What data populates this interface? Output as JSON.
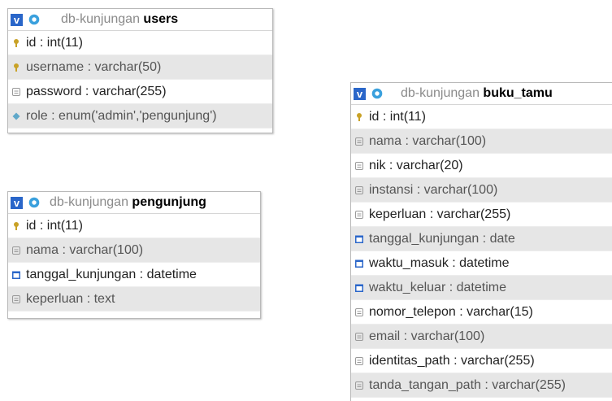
{
  "database": "db-kunjungan",
  "tables": [
    {
      "id": "users",
      "name": "users",
      "columns": [
        {
          "text": "id : int(11)",
          "icon": "key-icon"
        },
        {
          "text": "username : varchar(50)",
          "icon": "key-icon"
        },
        {
          "text": "password : varchar(255)",
          "icon": "column-icon"
        },
        {
          "text": "role : enum('admin','pengunjung')",
          "icon": "enum-icon"
        }
      ]
    },
    {
      "id": "pengunjung",
      "name": "pengunjung",
      "columns": [
        {
          "text": "id : int(11)",
          "icon": "key-icon"
        },
        {
          "text": "nama : varchar(100)",
          "icon": "column-icon"
        },
        {
          "text": "tanggal_kunjungan : datetime",
          "icon": "date-icon"
        },
        {
          "text": "keperluan : text",
          "icon": "column-icon"
        }
      ]
    },
    {
      "id": "buku_tamu",
      "name": "buku_tamu",
      "columns": [
        {
          "text": "id : int(11)",
          "icon": "key-icon"
        },
        {
          "text": "nama : varchar(100)",
          "icon": "column-icon"
        },
        {
          "text": "nik : varchar(20)",
          "icon": "column-icon"
        },
        {
          "text": "instansi : varchar(100)",
          "icon": "column-icon"
        },
        {
          "text": "keperluan : varchar(255)",
          "icon": "column-icon"
        },
        {
          "text": "tanggal_kunjungan : date",
          "icon": "date-icon"
        },
        {
          "text": "waktu_masuk : datetime",
          "icon": "date-icon"
        },
        {
          "text": "waktu_keluar : datetime",
          "icon": "date-icon"
        },
        {
          "text": "nomor_telepon : varchar(15)",
          "icon": "column-icon"
        },
        {
          "text": "email : varchar(100)",
          "icon": "column-icon"
        },
        {
          "text": "identitas_path : varchar(255)",
          "icon": "column-icon"
        },
        {
          "text": "tanda_tangan_path : varchar(255)",
          "icon": "column-icon"
        }
      ]
    }
  ],
  "colors": {
    "header_icon": "#2a66c9",
    "gear": "#3aa0dd",
    "key": "#c9a227",
    "date_icon": "#2a66c9"
  }
}
